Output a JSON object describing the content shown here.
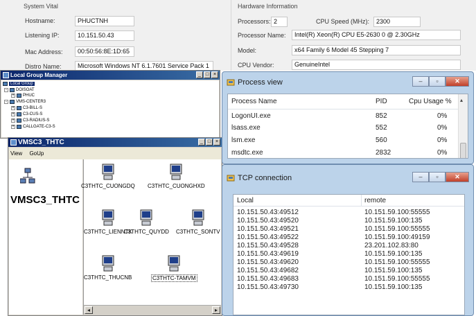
{
  "system_vital": {
    "title": "System Vital",
    "hostname_label": "Hostname:",
    "hostname": "PHUCTNH",
    "ip_label": "Listening IP:",
    "ip": "10.151.50.43",
    "mac_label": "Mac Address:",
    "mac": "00:50:56:8E:1D:65",
    "distro_label": "Distro Name:",
    "distro": "Microsoft Windows NT 6.1.7601 Service Pack 1"
  },
  "hardware": {
    "title": "Hardware Information",
    "processors_label": "Processors:",
    "processors": "2",
    "cpu_speed_label": "CPU Speed (MHz):",
    "cpu_speed": "2300",
    "processor_name_label": "Processor Name:",
    "processor_name": "Intel(R) Xeon(R) CPU E5-2630 0 @ 2.30GHz",
    "model_label": "Model:",
    "model": "x64 Family 6 Model 45 Stepping 7",
    "vendor_label": "CPU Vendor:",
    "vendor": "GenuineIntel"
  },
  "lgm": {
    "title": "Local Group Manager",
    "items": [
      "Local Group",
      "DOISOAT",
      "PHUC",
      "VMS-CENTER3",
      "C3-BILL-S",
      "C3-CUS-S",
      "C3-RADIUS-S",
      "CALLGATE-C3-S"
    ]
  },
  "process_view": {
    "title": "Process view",
    "headers": [
      "Process Name",
      "PID",
      "Cpu Usage %"
    ],
    "rows": [
      [
        "LogonUI.exe",
        "852",
        "0%"
      ],
      [
        "lsass.exe",
        "552",
        "0%"
      ],
      [
        "lsm.exe",
        "560",
        "0%"
      ],
      [
        "msdtc.exe",
        "2832",
        "0%"
      ]
    ]
  },
  "vmsc": {
    "title": "VMSC3_THTC",
    "menu": [
      "View",
      "GoUp"
    ],
    "root_label": "VMSC3_THTC",
    "nodes": [
      "C3THTC_CUONGDQ",
      "C3THTC_CUONGHXD",
      "C3THTC_LIENNTK",
      "C3THTC_QUYDD",
      "C3THTC_SONTV",
      "C3THTC_THUCNB",
      "C3THTC-TAMVM"
    ]
  },
  "tcp": {
    "title": "TCP connection",
    "headers": [
      "Local",
      "remote"
    ],
    "rows": [
      [
        "10.151.50.43:49512",
        "10.151.59.100:55555"
      ],
      [
        "10.151.50.43:49520",
        "10.151.59.100:135"
      ],
      [
        "10.151.50.43:49521",
        "10.151.59.100:55555"
      ],
      [
        "10.151.50.43:49522",
        "10.151.59.100:49159"
      ],
      [
        "10.151.50.43:49528",
        "23.201.102.83:80"
      ],
      [
        "10.151.50.43:49619",
        "10.151.59.100:135"
      ],
      [
        "10.151.50.43:49620",
        "10.151.59.100:55555"
      ],
      [
        "10.151.50.43:49682",
        "10.151.59.100:135"
      ],
      [
        "10.151.50.43:49683",
        "10.151.59.100:55555"
      ],
      [
        "10.151.50.43:49730",
        "10.151.59.100:135"
      ]
    ]
  }
}
